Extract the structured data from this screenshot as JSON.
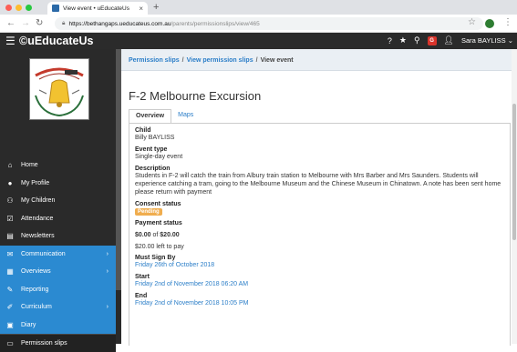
{
  "browser": {
    "tab_title": "View event • uEducateUs",
    "url_host": "https://bethangaps.ueducateus.com.au",
    "url_path": "/parents/permissionslips/view/465"
  },
  "app": {
    "brand": "©uEducateUs",
    "user_name": "Sara BAYLISS"
  },
  "sidebar": {
    "items": [
      {
        "label": "Home",
        "icon": "home-icon"
      },
      {
        "label": "My Profile",
        "icon": "user-icon"
      },
      {
        "label": "My Children",
        "icon": "children-icon"
      },
      {
        "label": "Attendance",
        "icon": "checkbox-icon"
      },
      {
        "label": "Newsletters",
        "icon": "newspaper-icon"
      },
      {
        "label": "Communication",
        "icon": "envelope-icon"
      },
      {
        "label": "Overviews",
        "icon": "table-icon"
      },
      {
        "label": "Reporting",
        "icon": "reporting-icon"
      },
      {
        "label": "Curriculum",
        "icon": "edit-icon"
      },
      {
        "label": "Diary",
        "icon": "calendar-icon"
      },
      {
        "label": "Permission slips",
        "icon": "document-icon"
      }
    ]
  },
  "breadcrumb": {
    "item1": "Permission slips",
    "item2": "View permission slips",
    "current": "View event",
    "separator": "/"
  },
  "page": {
    "title": "F-2 Melbourne Excursion",
    "tabs": [
      "Overview",
      "Maps"
    ]
  },
  "event": {
    "child_label": "Child",
    "child": "Billy BAYLISS",
    "type_label": "Event type",
    "type": "Single-day event",
    "description_label": "Description",
    "description": "Students in F-2 will catch the train from Albury train station to Melbourne with Mrs Barber and Mrs Saunders. Students will experience catching a tram, going to the Melbourne Museum and the Chinese Museum in Chinatown. A note has been sent home please return with payment",
    "consent_label": "Consent status",
    "consent": "Pending",
    "payment_label": "Payment status",
    "paid": "$0.00",
    "of": "of",
    "total": "$20.00",
    "left_to_pay": "$20.00 left to pay",
    "sign_by_label": "Must Sign By",
    "sign_by": "Friday 26th of October 2018",
    "start_label": "Start",
    "start": "Friday 2nd of November 2018 06:20 AM",
    "end_label": "End",
    "end": "Friday 2nd of November 2018 10:05 PM"
  },
  "colors": {
    "accent": "#2b7ec8",
    "sidebar_active": "#2b8ad1",
    "badge": "#f0ad4e",
    "header": "#2b2b2b"
  }
}
